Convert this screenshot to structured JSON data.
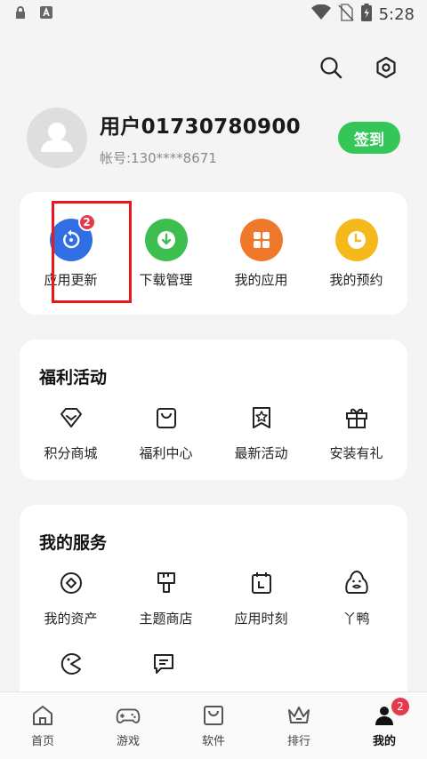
{
  "status_bar": {
    "time": "5:28"
  },
  "header": {
    "search_icon": "search-icon",
    "settings_icon": "settings-hex-icon"
  },
  "profile": {
    "username": "用户01730780900",
    "account": "帐号:130****8671",
    "checkin_label": "签到"
  },
  "quick_actions": [
    {
      "label": "应用更新",
      "badge": "2",
      "color": "#2f6fe3",
      "icon": "update-icon"
    },
    {
      "label": "下载管理",
      "color": "#3cbf4e",
      "icon": "download-icon"
    },
    {
      "label": "我的应用",
      "color": "#f0782a",
      "icon": "apps-icon"
    },
    {
      "label": "我的预约",
      "color": "#f5b91c",
      "icon": "clock-icon"
    }
  ],
  "welfare": {
    "title": "福利活动",
    "items": [
      {
        "label": "积分商城",
        "icon": "diamond-icon"
      },
      {
        "label": "福利中心",
        "icon": "bag-icon"
      },
      {
        "label": "最新活动",
        "icon": "star-flag-icon"
      },
      {
        "label": "安装有礼",
        "icon": "gift-icon"
      }
    ]
  },
  "services": {
    "title": "我的服务",
    "items": [
      {
        "label": "我的资产",
        "icon": "coin-icon"
      },
      {
        "label": "主题商店",
        "icon": "brush-icon"
      },
      {
        "label": "应用时刻",
        "icon": "calendar-icon"
      },
      {
        "label": "丫鸭",
        "icon": "duck-icon"
      },
      {
        "label": "",
        "icon": "pacman-icon"
      },
      {
        "label": "",
        "icon": "message-icon"
      }
    ]
  },
  "bottom_nav": [
    {
      "label": "首页",
      "icon": "home-icon"
    },
    {
      "label": "游戏",
      "icon": "gamepad-icon"
    },
    {
      "label": "软件",
      "icon": "shopping-bag-icon"
    },
    {
      "label": "排行",
      "icon": "crown-icon"
    },
    {
      "label": "我的",
      "icon": "person-icon",
      "badge": "2",
      "active": true
    }
  ]
}
